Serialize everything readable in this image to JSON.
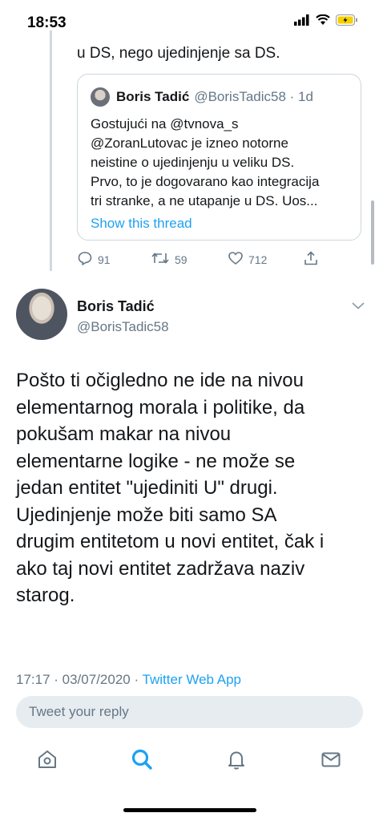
{
  "status_bar": {
    "time": "18:53"
  },
  "previous_tweet": {
    "text_tail": "u DS, nego ujedinjenje sa DS.",
    "quote": {
      "name": "Boris Tadić",
      "handle_date": "@BorisTadic58 · 1d",
      "lines": [
        "Gostujući na @tvnova_s",
        "@ZoranLutovac je izneo notorne",
        "neistine o ujedinjenju u veliku DS.",
        "Prvo, to je dogovarano kao integracija",
        "tri stranke, a ne utapanje u DS. Uos..."
      ],
      "show_thread": "Show this thread"
    },
    "actions": {
      "replies": "91",
      "retweets": "59",
      "likes": "712"
    }
  },
  "tweet": {
    "name": "Boris Tadić",
    "handle": "@BorisTadic58",
    "lines": [
      "Pošto ti očigledno ne ide na nivou",
      "elementarnog morala i politike, da",
      "pokušam makar na nivou",
      "elementarne logike - ne može se",
      "jedan entitet \"ujediniti U\" drugi.",
      "Ujedinjenje može biti samo SA",
      "drugim entitetom u novi entitet, čak i",
      "ako taj novi entitet zadržava naziv",
      "starog."
    ],
    "time_date": "17:17 · 03/07/2020 · ",
    "source": "Twitter Web App"
  },
  "reply": {
    "placeholder": "Tweet your reply"
  },
  "colors": {
    "accent": "#1da1f2",
    "muted": "#657786",
    "text": "#14171a"
  },
  "icons": [
    "signal-icon",
    "wifi-icon",
    "battery-icon",
    "reply-icon",
    "retweet-icon",
    "like-icon",
    "share-icon",
    "chevron-down-icon",
    "home-icon",
    "search-icon",
    "notifications-icon",
    "messages-icon"
  ]
}
